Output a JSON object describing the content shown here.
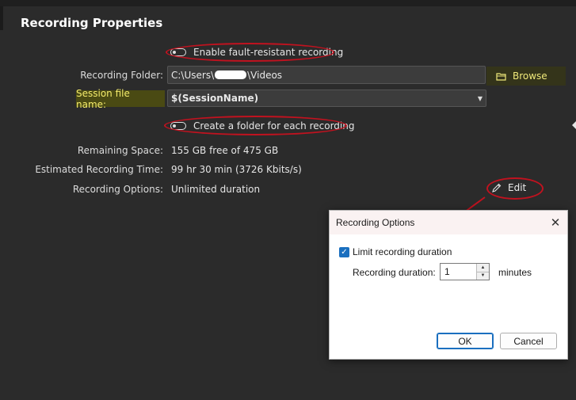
{
  "panel": {
    "title": "Recording Properties"
  },
  "fault_toggle": {
    "label": "Enable fault-resistant recording"
  },
  "folder": {
    "label": "Recording Folder:",
    "value_prefix": "C:\\Users\\",
    "value_suffix": "\\Videos",
    "browse_label": "Browse"
  },
  "session": {
    "label": "Session file name:",
    "value": "$(SessionName)"
  },
  "folder_toggle": {
    "label": "Create a folder for each recording"
  },
  "info": {
    "remaining_label": "Remaining Space:",
    "remaining_value": "155 GB free of 475 GB",
    "time_label": "Estimated Recording Time:",
    "time_value": "99 hr 30 min (3726 Kbits/s)",
    "options_label": "Recording Options:",
    "options_value": "Unlimited duration",
    "edit_label": "Edit"
  },
  "dialog": {
    "title": "Recording Options",
    "checkbox_label": "Limit recording duration",
    "duration_label": "Recording duration:",
    "duration_value": "1",
    "unit": "minutes",
    "ok_label": "OK",
    "cancel_label": "Cancel"
  },
  "colors": {
    "background": "#2b2b2b",
    "highlight_yellow": "#f3ea6b",
    "annotation_red": "#c1121f",
    "checkbox_blue": "#1a6fbf"
  },
  "icons": [
    "folder-icon",
    "pencil-icon",
    "close-icon",
    "checkmark-icon",
    "dropdown-arrow-icon"
  ]
}
